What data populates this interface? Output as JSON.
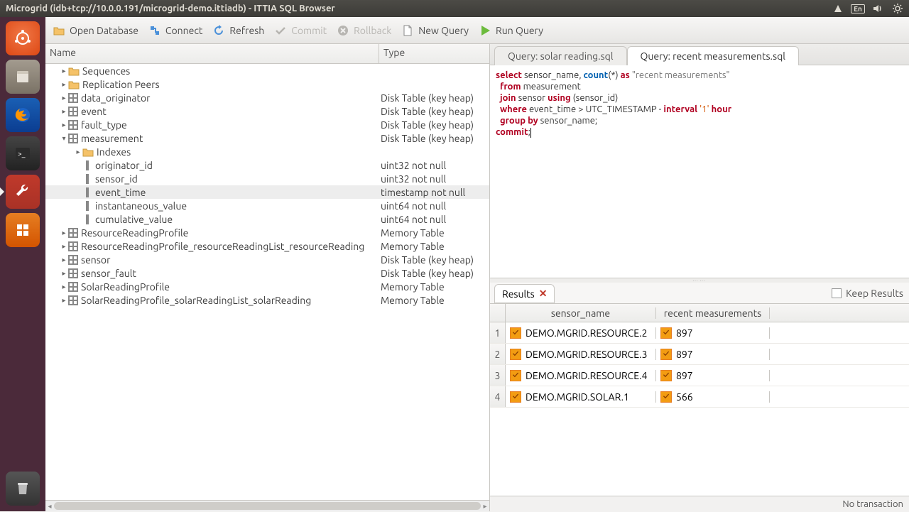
{
  "window_title": "Microgrid (idb+tcp://10.0.0.191/microgrid-demo.ittiadb) - ITTIA SQL Browser",
  "system_tray": {
    "lang": "En"
  },
  "toolbar": {
    "open": "Open Database",
    "connect": "Connect",
    "refresh": "Refresh",
    "commit": "Commit",
    "rollback": "Rollback",
    "new_query": "New Query",
    "run_query": "Run Query"
  },
  "tree": {
    "headers": {
      "name": "Name",
      "type": "Type"
    },
    "rows": [
      {
        "indent": 1,
        "expander": "▸",
        "icon": "folder",
        "name": "Sequences",
        "type": ""
      },
      {
        "indent": 1,
        "expander": "▸",
        "icon": "folder",
        "name": "Replication Peers",
        "type": ""
      },
      {
        "indent": 1,
        "expander": "▸",
        "icon": "table",
        "name": "data_originator",
        "type": "Disk Table (key heap)"
      },
      {
        "indent": 1,
        "expander": "▸",
        "icon": "table",
        "name": "event",
        "type": "Disk Table (key heap)"
      },
      {
        "indent": 1,
        "expander": "▸",
        "icon": "table",
        "name": "fault_type",
        "type": "Disk Table (key heap)"
      },
      {
        "indent": 1,
        "expander": "▾",
        "icon": "table",
        "name": "measurement",
        "type": "Disk Table (key heap)"
      },
      {
        "indent": 2,
        "expander": "▸",
        "icon": "folder",
        "name": "Indexes",
        "type": ""
      },
      {
        "indent": 2,
        "expander": "",
        "icon": "column",
        "name": "originator_id",
        "type": "uint32 not null"
      },
      {
        "indent": 2,
        "expander": "",
        "icon": "column",
        "name": "sensor_id",
        "type": "uint32 not null"
      },
      {
        "indent": 2,
        "expander": "",
        "icon": "column",
        "name": "event_time",
        "type": "timestamp not null",
        "selected": true
      },
      {
        "indent": 2,
        "expander": "",
        "icon": "column",
        "name": "instantaneous_value",
        "type": "uint64 not null"
      },
      {
        "indent": 2,
        "expander": "",
        "icon": "column",
        "name": "cumulative_value",
        "type": "uint64 not null"
      },
      {
        "indent": 1,
        "expander": "▸",
        "icon": "table",
        "name": "ResourceReadingProfile",
        "type": "Memory Table"
      },
      {
        "indent": 1,
        "expander": "▸",
        "icon": "table",
        "name": "ResourceReadingProfile_resourceReadingList_resourceReading",
        "type": "Memory Table"
      },
      {
        "indent": 1,
        "expander": "▸",
        "icon": "table",
        "name": "sensor",
        "type": "Disk Table (key heap)"
      },
      {
        "indent": 1,
        "expander": "▸",
        "icon": "table",
        "name": "sensor_fault",
        "type": "Disk Table (key heap)"
      },
      {
        "indent": 1,
        "expander": "▸",
        "icon": "table",
        "name": "SolarReadingProfile",
        "type": "Memory Table"
      },
      {
        "indent": 1,
        "expander": "▸",
        "icon": "table",
        "name": "SolarReadingProfile_solarReadingList_solarReading",
        "type": "Memory Table"
      }
    ]
  },
  "query": {
    "tabs": [
      {
        "label": "Query: solar reading.sql",
        "active": false
      },
      {
        "label": "Query: recent measurements.sql",
        "active": true
      }
    ],
    "sql_tokens": [
      [
        {
          "t": "select",
          "c": "kw"
        },
        {
          "t": " sensor_name, "
        },
        {
          "t": "count",
          "c": "fn"
        },
        {
          "t": "(*) "
        },
        {
          "t": "as",
          "c": "kw"
        },
        {
          "t": " "
        },
        {
          "t": "\"recent measurements\"",
          "c": "str"
        }
      ],
      [
        {
          "t": "  "
        },
        {
          "t": "from",
          "c": "kw"
        },
        {
          "t": " measurement"
        }
      ],
      [
        {
          "t": "  "
        },
        {
          "t": "join",
          "c": "kw"
        },
        {
          "t": " sensor "
        },
        {
          "t": "using",
          "c": "kw"
        },
        {
          "t": " (sensor_id)"
        }
      ],
      [
        {
          "t": "  "
        },
        {
          "t": "where",
          "c": "kw"
        },
        {
          "t": " event_time > UTC_TIMESTAMP - "
        },
        {
          "t": "interval",
          "c": "typ"
        },
        {
          "t": " "
        },
        {
          "t": "'1'",
          "c": "num"
        },
        {
          "t": " "
        },
        {
          "t": "hour",
          "c": "typ"
        }
      ],
      [
        {
          "t": "  "
        },
        {
          "t": "group",
          "c": "kw"
        },
        {
          "t": " "
        },
        {
          "t": "by",
          "c": "kw"
        },
        {
          "t": " sensor_name;"
        }
      ],
      [
        {
          "t": ""
        }
      ],
      [
        {
          "t": "commit",
          "c": "kw"
        },
        {
          "t": ";"
        },
        {
          "t": "",
          "cursor": true
        }
      ]
    ]
  },
  "results": {
    "tab_label": "Results",
    "keep_label": "Keep Results",
    "columns": [
      "sensor_name",
      "recent measurements"
    ],
    "rows": [
      {
        "idx": "1",
        "name": "DEMO.MGRID.RESOURCE.2",
        "meas": "897"
      },
      {
        "idx": "2",
        "name": "DEMO.MGRID.RESOURCE.3",
        "meas": "897"
      },
      {
        "idx": "3",
        "name": "DEMO.MGRID.RESOURCE.4",
        "meas": "897"
      },
      {
        "idx": "4",
        "name": "DEMO.MGRID.SOLAR.1",
        "meas": "566"
      }
    ]
  },
  "status": "No transaction"
}
